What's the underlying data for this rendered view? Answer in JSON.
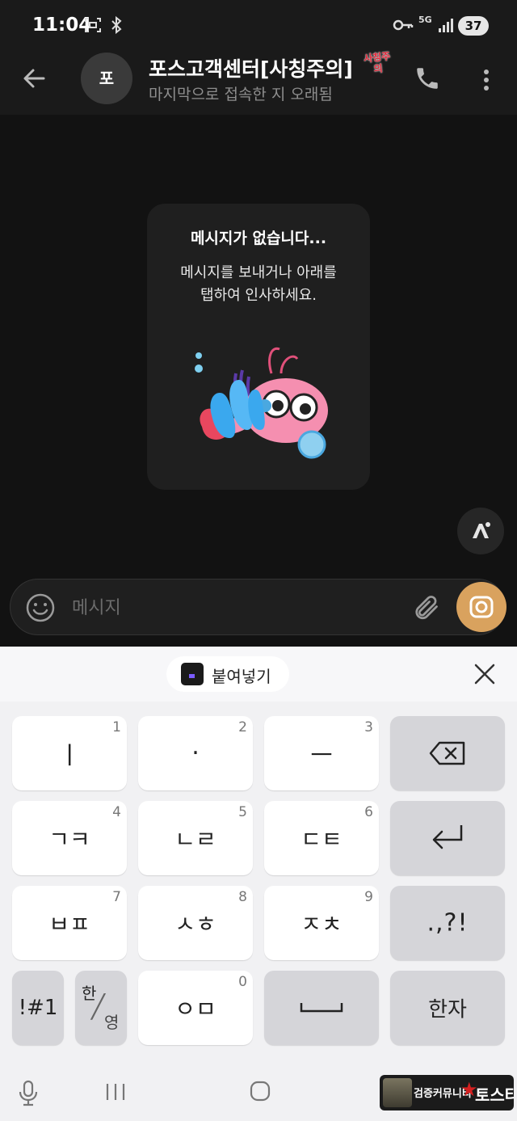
{
  "status_bar": {
    "time": "11:04",
    "battery": "37",
    "network": "5G"
  },
  "header": {
    "avatar_initial": "포",
    "title": "포스고객센터[사칭주의]",
    "warning_sticker": "사칭주의",
    "subtitle": "마지막으로 접속한 지 오래됨"
  },
  "chat": {
    "empty_title": "메시지가 없습니다...",
    "empty_text": "메시지를 보내거나 아래를\n탭하여 인사하세요."
  },
  "composer": {
    "placeholder": "메시지"
  },
  "keyboard": {
    "paste_label": "붙여넣기",
    "rows": [
      [
        {
          "label": "ㅣ",
          "hint": "1"
        },
        {
          "label": "·",
          "hint": "2"
        },
        {
          "label": "ㅡ",
          "hint": "3"
        },
        {
          "label": "",
          "hint": "",
          "icon": "backspace-icon"
        }
      ],
      [
        {
          "label": "ㄱㅋ",
          "hint": "4"
        },
        {
          "label": "ㄴㄹ",
          "hint": "5"
        },
        {
          "label": "ㄷㅌ",
          "hint": "6"
        },
        {
          "label": "",
          "hint": "",
          "icon": "enter-icon"
        }
      ],
      [
        {
          "label": "ㅂㅍ",
          "hint": "7"
        },
        {
          "label": "ㅅㅎ",
          "hint": "8"
        },
        {
          "label": "ㅈㅊ",
          "hint": "9"
        },
        {
          "label": ".,?!",
          "hint": ""
        }
      ],
      [
        {
          "label": "!#1",
          "hint": ""
        },
        {
          "label": "한",
          "label2": "영",
          "hint": ""
        },
        {
          "label": "ㅇㅁ",
          "hint": "0"
        },
        {
          "label": "",
          "hint": "",
          "icon": "space-icon"
        },
        {
          "label": "한자",
          "hint": ""
        }
      ]
    ]
  },
  "watermark": {
    "text": "검증커뮤니티",
    "brand": "토스타"
  }
}
